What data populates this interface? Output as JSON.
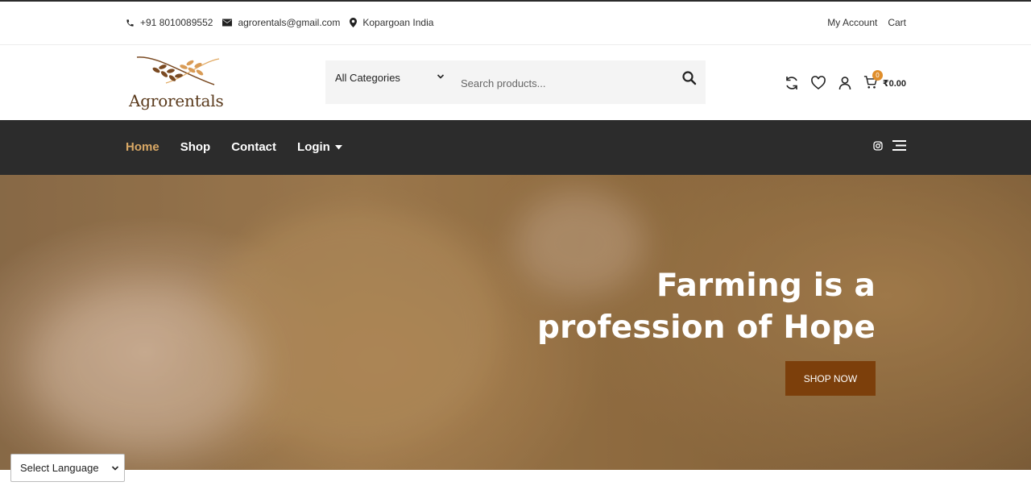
{
  "topbar": {
    "phone": "+91 8010089552",
    "email": "agrorentals@gmail.com",
    "location": "Kopargoan India",
    "my_account": "My Account",
    "cart": "Cart"
  },
  "header": {
    "logo_text": "Agrorentals",
    "category_select": "All Categories",
    "search_placeholder": "Search products...",
    "cart_count": "0",
    "cart_total": "₹0.00"
  },
  "nav": {
    "items": [
      {
        "label": "Home",
        "active": true
      },
      {
        "label": "Shop"
      },
      {
        "label": "Contact"
      },
      {
        "label": "Login"
      }
    ]
  },
  "hero": {
    "headline_line1": "Farming is a",
    "headline_line2": "profession of Hope",
    "button_label": "SHOP NOW"
  },
  "language": {
    "selected": "Select Language"
  },
  "colors": {
    "accent": "#d9a865",
    "nav_bg": "#2c2c2c",
    "button_bg": "#7c3f0b",
    "badge": "#e08e2b"
  }
}
